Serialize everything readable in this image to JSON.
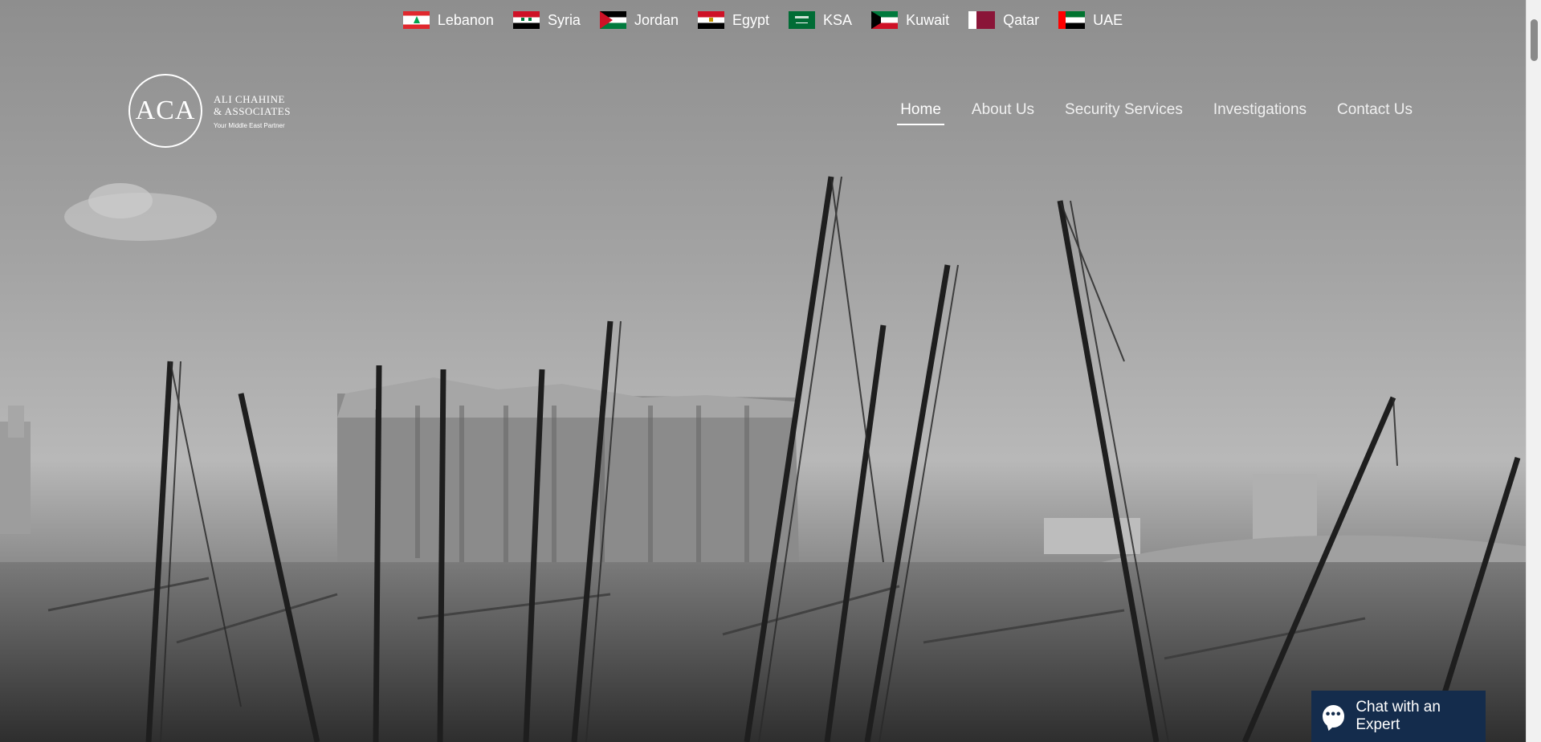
{
  "countries": [
    {
      "name": "Lebanon",
      "icon": "lebanon-flag-icon"
    },
    {
      "name": "Syria",
      "icon": "syria-flag-icon"
    },
    {
      "name": "Jordan",
      "icon": "jordan-flag-icon"
    },
    {
      "name": "Egypt",
      "icon": "egypt-flag-icon"
    },
    {
      "name": "KSA",
      "icon": "ksa-flag-icon"
    },
    {
      "name": "Kuwait",
      "icon": "kuwait-flag-icon"
    },
    {
      "name": "Qatar",
      "icon": "qatar-flag-icon"
    },
    {
      "name": "UAE",
      "icon": "uae-flag-icon"
    }
  ],
  "logo": {
    "mark": "ACA",
    "line1": "ALI CHAHINE",
    "line2": "& ASSOCIATES",
    "tagline": "Your Middle East Partner"
  },
  "nav": {
    "items": [
      "Home",
      "About Us",
      "Security Services",
      "Investigations",
      "Contact Us"
    ],
    "active": "Home"
  },
  "chat": {
    "label": "Chat with an Expert",
    "icon": "chat-bubble-icon",
    "color": "#142c4c"
  },
  "hero": {
    "image": "grayscale photo of damaged grain silos and cranes at a port"
  }
}
